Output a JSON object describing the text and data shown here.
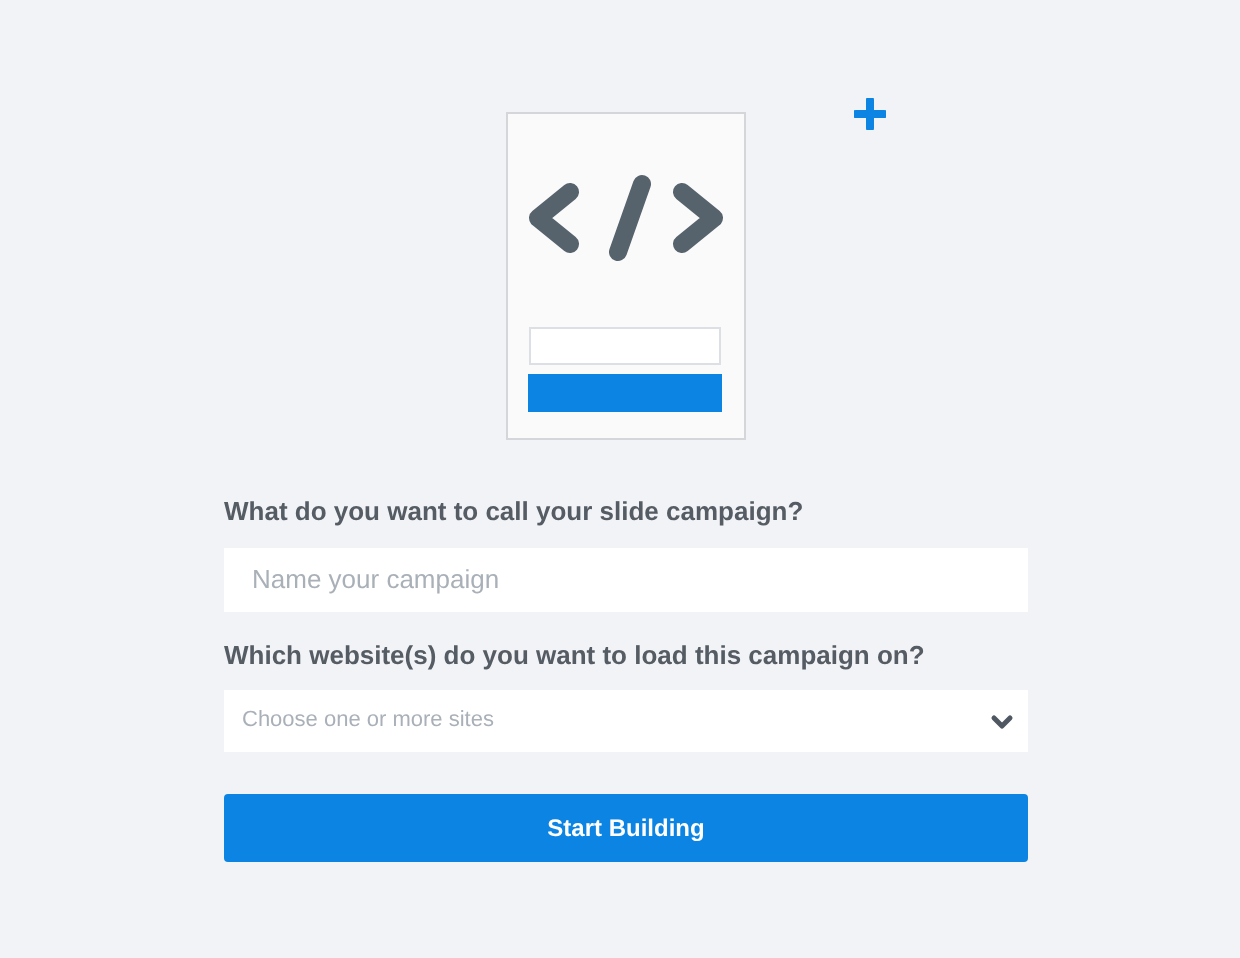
{
  "name_field": {
    "label": "What do you want to call your slide campaign?",
    "placeholder": "Name your campaign"
  },
  "sites_select": {
    "label": "Which website(s) do you want to load this campaign on?",
    "placeholder": "Choose one or more sites"
  },
  "submit_button": {
    "label": "Start Building"
  }
}
